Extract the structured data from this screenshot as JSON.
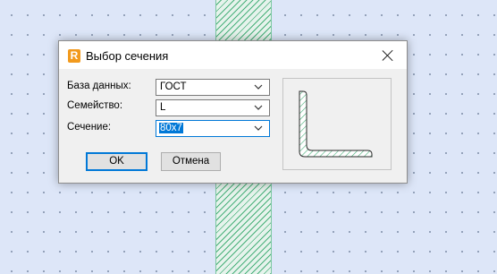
{
  "dialog": {
    "title": "Выбор сечения",
    "app_icon_letter": "R",
    "fields": {
      "database": {
        "label": "База данных:",
        "value": "ГОСТ"
      },
      "family": {
        "label": "Семейство:",
        "value": "L"
      },
      "section": {
        "label": "Сечение:",
        "value": "80x7"
      }
    },
    "buttons": {
      "ok": "OK",
      "cancel": "Отмена"
    }
  },
  "colors": {
    "accent": "#0078d7",
    "app_icon": "#f29a1d",
    "hatch": "#48b07a",
    "canvas_background": "#dde6f8"
  },
  "icons": [
    "close-icon",
    "chevron-down-icon",
    "app-icon"
  ]
}
